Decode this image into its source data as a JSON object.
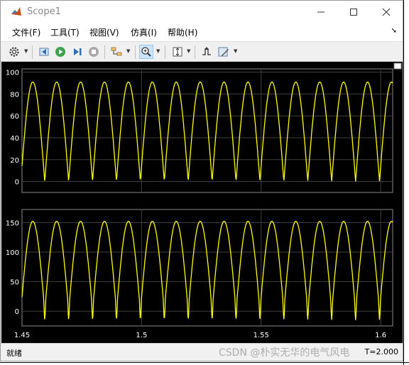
{
  "window": {
    "title": "Scope1"
  },
  "menu": [
    "文件(F)",
    "工具(T)",
    "视图(V)",
    "仿真(I)",
    "帮助(H)"
  ],
  "toolbar": {
    "buttons": [
      "settings-icon",
      "step-back-icon",
      "run-icon",
      "step-forward-icon",
      "stop-icon",
      "signal-selector-icon",
      "zoom-icon",
      "autoscale-icon",
      "triggers-icon",
      "style-icon"
    ]
  },
  "status": {
    "left": "就绪",
    "right": "T=2.000"
  },
  "watermark": "CSDN @朴实无华的电气风电",
  "colors": {
    "trace": "#ffff00",
    "grid": "#404040",
    "plot_bg": "#000000",
    "axes_bg": "#000000"
  },
  "chart_data": [
    {
      "type": "line",
      "title": "",
      "xlabel": "",
      "ylabel": "",
      "xlim": [
        1.45,
        1.605
      ],
      "ylim": [
        -10,
        103
      ],
      "yticks": [
        0,
        20,
        40,
        60,
        80,
        100
      ],
      "ytick_labels": [
        "0",
        "20",
        "40",
        "60",
        "80",
        "100"
      ],
      "grid": true,
      "series": [
        {
          "waveform": "rectified-sine",
          "amplitude": 91,
          "period": 0.01,
          "first_peak_x": 1.4545,
          "min": 0,
          "max": 91
        }
      ]
    },
    {
      "type": "line",
      "title": "",
      "xlabel": "",
      "ylabel": "",
      "xlim": [
        1.45,
        1.605
      ],
      "ylim": [
        -25,
        172
      ],
      "yticks": [
        0,
        50,
        100,
        150
      ],
      "ytick_labels": [
        "0",
        "50",
        "100",
        "150"
      ],
      "xticks": [
        1.45,
        1.5,
        1.55,
        1.6
      ],
      "xtick_labels": [
        "1.45",
        "1.5",
        "1.55",
        "1.6"
      ],
      "grid": true,
      "series": [
        {
          "waveform": "rectified-sine",
          "amplitude": 152,
          "period": 0.01,
          "first_peak_x": 1.4545,
          "min": -15,
          "max": 152
        }
      ]
    }
  ]
}
